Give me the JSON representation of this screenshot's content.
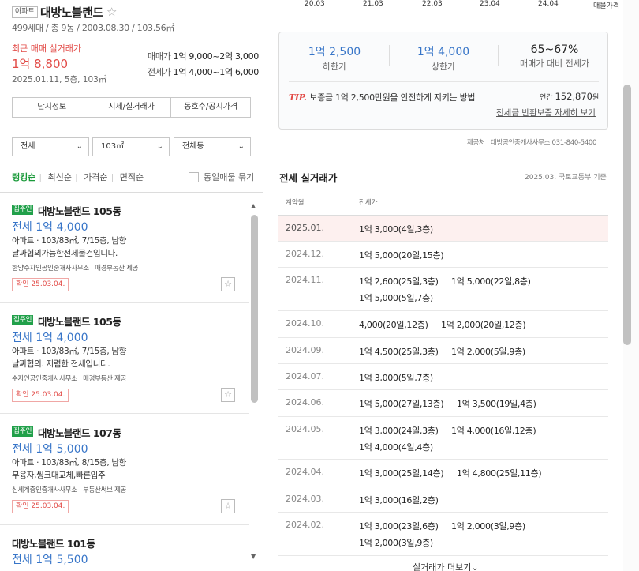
{
  "complex": {
    "type_badge": "아파트",
    "name": "대방노블랜드",
    "info": "499세대 / 총 9동 / 2003.08.30 / 103.56㎡",
    "recent_label": "최근 매매 실거래가",
    "recent_price": "1억 8,800",
    "recent_date": "2025.01.11, 5층, 103㎡",
    "sale_label": "매매가",
    "sale_range": "1억 9,000~2억 3,000",
    "jeonse_label": "전세가",
    "jeonse_range": "1억 4,000~1억 6,000"
  },
  "tabs": [
    "단지정보",
    "시세/실거래가",
    "동호수/공시가격"
  ],
  "filters": {
    "deal": "전세",
    "area": "103㎡",
    "dong": "전체동"
  },
  "sort": {
    "items": [
      "랭킹순",
      "최신순",
      "가격순",
      "면적순"
    ],
    "same_toggle": "동일매물 묶기"
  },
  "listings": [
    {
      "badge": "집주인",
      "title": "대방노블랜드 105동",
      "price": "전세 1억 4,000",
      "spec": "아파트 · 103/83㎡, 7/15층, 남향",
      "desc": "날짜협의가능한전세물건입니다.",
      "agent": "한양수자인공인중개사사무소 | 매경부동산 제공",
      "confirm": "확인 25.03.04."
    },
    {
      "badge": "집주인",
      "title": "대방노블랜드 105동",
      "price": "전세 1억 4,000",
      "spec": "아파트 · 103/83㎡, 7/15층, 남향",
      "desc": "날짜협의. 저렴한 전세입니다.",
      "agent": "수자인공인중개사사무소 | 매경부동산 제공",
      "confirm": "확인 25.03.04."
    },
    {
      "badge": "집주인",
      "title": "대방노블랜드 107동",
      "price": "전세 1억 5,000",
      "spec": "아파트 · 103/83㎡, 8/15층, 남향",
      "desc": "무융자,씽크대교체,빠른입주",
      "agent": "신세계중인중개사사무소 | 부동산써브 제공",
      "confirm": "확인 25.03.04."
    },
    {
      "badge": "",
      "title": "대방노블랜드 101동",
      "price": "전세 1억 5,500",
      "spec": "",
      "desc": "",
      "agent": "",
      "confirm": ""
    }
  ],
  "axis_dates": [
    "20.03",
    "21.03",
    "22.03",
    "23.04",
    "24.04",
    "매물가격"
  ],
  "stats": {
    "low_value": "1억 2,500",
    "low_label": "하한가",
    "high_value": "1억 4,000",
    "high_label": "상한가",
    "ratio_value": "65~67%",
    "ratio_label": "매매가 대비 전세가"
  },
  "tip": {
    "prefix": "TIP.",
    "text": "보증금 1억 2,500만원을 안전하게 지키는 방법",
    "yearly_label": "연간",
    "yearly_value": "152,870",
    "yearly_unit": "원",
    "link": "전세금 반환보증 자세히 보기"
  },
  "source": "제공처 : 대방공인중개사사무소 031-840-5400",
  "history": {
    "title": "전세 실거래가",
    "note": "2025.03. 국토교통부 기준",
    "col_month": "계약월",
    "col_price": "전세가",
    "rows": [
      {
        "month": "2025.01.",
        "deals": [
          "1억 3,000(4일,3층)"
        ]
      },
      {
        "month": "2024.12.",
        "deals": [
          "1억 5,000(20일,15층)"
        ]
      },
      {
        "month": "2024.11.",
        "deals": [
          "1억 2,600(25일,3층)",
          "1억 5,000(22일,8층)",
          "1억 5,000(5일,7층)"
        ]
      },
      {
        "month": "2024.10.",
        "deals": [
          "4,000(20일,12층)",
          "1억 2,000(20일,12층)"
        ]
      },
      {
        "month": "2024.09.",
        "deals": [
          "1억 4,500(25일,3층)",
          "1억 2,000(5일,9층)"
        ]
      },
      {
        "month": "2024.07.",
        "deals": [
          "1억 3,000(5일,7층)"
        ]
      },
      {
        "month": "2024.06.",
        "deals": [
          "1억 5,000(27일,13층)",
          "1억 3,500(19일,4층)"
        ]
      },
      {
        "month": "2024.05.",
        "deals": [
          "1억 3,000(24일,3층)",
          "1억 4,000(16일,12층)",
          "1억 4,000(4일,4층)"
        ]
      },
      {
        "month": "2024.04.",
        "deals": [
          "1억 3,000(25일,14층)",
          "1억 4,800(25일,11층)"
        ]
      },
      {
        "month": "2024.03.",
        "deals": [
          "1억 3,000(16일,2층)"
        ]
      },
      {
        "month": "2024.02.",
        "deals": [
          "1억 3,000(23일,6층)",
          "1억 2,000(3일,9층)",
          "1억 2,000(3일,9층)"
        ]
      }
    ],
    "more": "실거래가 더보기⌄"
  },
  "colors": {
    "accent_red": "#e24b47",
    "price_blue": "#3775c8",
    "green": "#21a04a"
  }
}
